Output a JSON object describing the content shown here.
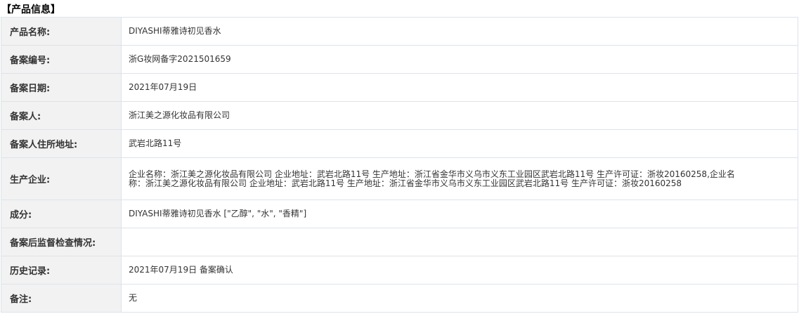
{
  "section": {
    "title": "【产品信息】"
  },
  "rows": [
    {
      "label": "产品名称:",
      "value": "DIYASHI蒂雅诗初见香水"
    },
    {
      "label": "备案编号:",
      "value": "浙G妆网备字2021501659"
    },
    {
      "label": "备案日期:",
      "value": "2021年07月19日"
    },
    {
      "label": "备案人:",
      "value": "浙江美之源化妆品有限公司"
    },
    {
      "label": "备案人住所地址:",
      "value": "武岩北路11号"
    },
    {
      "label": "生产企业:",
      "value": "企业名称：浙江美之源化妆品有限公司 企业地址：武岩北路11号 生产地址：浙江省金华市义乌市义东工业园区武岩北路11号 生产许可证：浙妆20160258,企业名称：浙江美之源化妆品有限公司 企业地址：武岩北路11号 生产地址：浙江省金华市义乌市义东工业园区武岩北路11号 生产许可证：浙妆20160258"
    },
    {
      "label": "成分:",
      "value": "DIYASHI蒂雅诗初见香水 [\"乙醇\", \"水\", \"香精\"]"
    },
    {
      "label": "备案后监督检查情况:",
      "value": ""
    },
    {
      "label": "历史记录:",
      "value": "2021年07月19日 备案确认"
    },
    {
      "label": "备注:",
      "value": "无"
    }
  ]
}
